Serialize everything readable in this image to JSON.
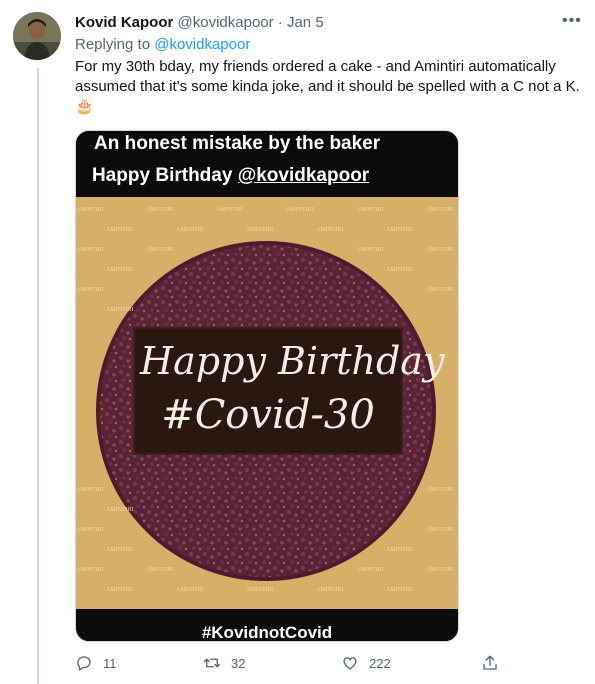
{
  "tweet": {
    "author_name": "Kovid Kapoor",
    "author_handle": "@kovidkapoor",
    "separator": "·",
    "date": "Jan 5",
    "replying_prefix": "Replying to",
    "replying_to": "@kovidkapoor",
    "text": "For my 30th bday, my friends ordered a cake - and Amintiri automatically assumed that it's some kinda joke, and it should be spelled with a C not a K. 🎂",
    "more_icon": "more-horizontal-icon"
  },
  "media": {
    "caption_top": "An honest mistake by the baker",
    "caption_line2_prefix": "Happy Birthday ",
    "caption_line2_handle": "@kovidkapoor",
    "plaque_line1": "Happy Birthday",
    "plaque_line2": "#Covid-30",
    "box_brand": "AMINTIRI",
    "caption_bottom": "#KovidnotCovid"
  },
  "actions": {
    "replies": "11",
    "retweets": "32",
    "likes": "222",
    "icons": [
      "reply-icon",
      "retweet-icon",
      "like-icon",
      "share-icon"
    ]
  },
  "colors": {
    "link": "#1d9bf0",
    "muted": "#536471",
    "cake_top": "#5e2a3c",
    "box": "#d9b36a"
  }
}
